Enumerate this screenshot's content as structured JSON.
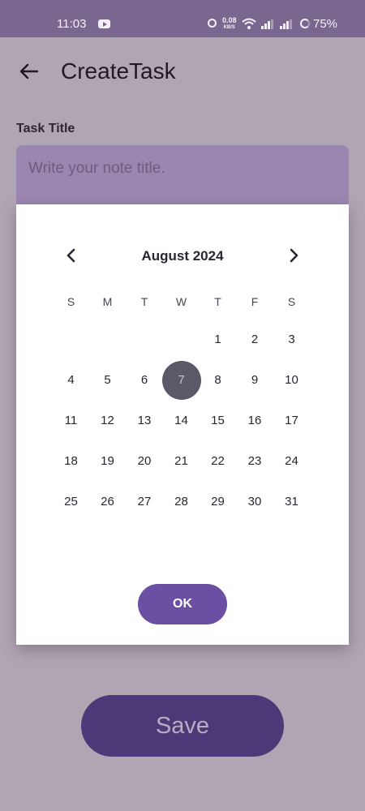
{
  "status_bar": {
    "time": "11:03",
    "net_speed_value": "0.08",
    "net_speed_unit": "KB/S",
    "battery": "75%"
  },
  "header": {
    "title": "CreateTask"
  },
  "form": {
    "task_title_label": "Task Title",
    "task_title_placeholder": "Write your note title."
  },
  "date_picker": {
    "month_label": "August 2024",
    "weekdays": [
      "S",
      "M",
      "T",
      "W",
      "T",
      "F",
      "S"
    ],
    "first_weekday_index": 4,
    "days_in_month": 31,
    "selected_day": 7,
    "ok_label": "OK"
  },
  "save_label": "Save",
  "colors": {
    "status_bar": "#7a6790",
    "accent": "#6a4fa3",
    "save_button": "#4b3a77",
    "selected_day": "#5c5868",
    "scrim": "#b0a5b3"
  }
}
